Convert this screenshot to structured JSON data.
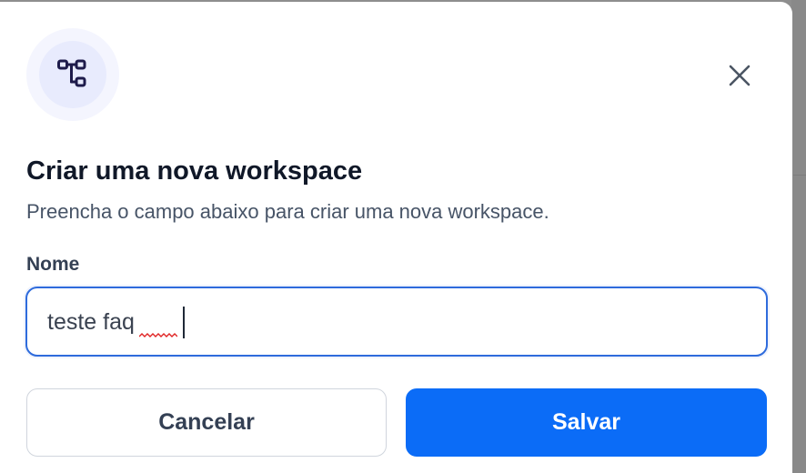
{
  "dialog": {
    "title": "Criar uma nova workspace",
    "subtitle": "Preencha o campo abaixo para criar uma nova workspace.",
    "header_icon": "workflow-icon",
    "close_icon": "close-icon"
  },
  "form": {
    "name_label": "Nome",
    "name_value": "teste faq",
    "misspelled_word": "faq"
  },
  "actions": {
    "cancel_label": "Cancelar",
    "save_label": "Salvar"
  },
  "colors": {
    "primary": "#0b6cf7",
    "focus_border": "#2e6bdc",
    "icon_accent": "#1e1b4b",
    "icon_ring": "#f4f5fe"
  }
}
